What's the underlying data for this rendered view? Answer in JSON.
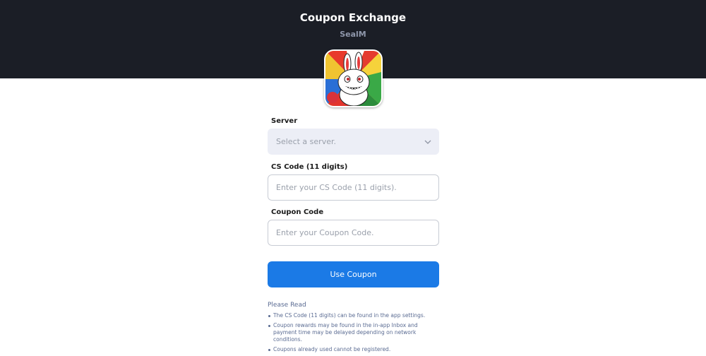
{
  "header": {
    "title": "Coupon Exchange",
    "game_name": "SealM"
  },
  "form": {
    "server": {
      "label": "Server",
      "placeholder": "Select a server."
    },
    "cs_code": {
      "label": "CS Code (11 digits)",
      "placeholder": "Enter your CS Code (11 digits)."
    },
    "coupon_code": {
      "label": "Coupon Code",
      "placeholder": "Enter your Coupon Code."
    },
    "submit_label": "Use Coupon"
  },
  "notes": {
    "title": "Please Read",
    "items": [
      "The CS Code (11 digits) can be found in the app settings.",
      "Coupon rewards may be found in the in-app Inbox and payment time may be delayed depending on network conditions.",
      "Coupons already used cannot be registered."
    ]
  },
  "colors": {
    "header_bg": "#1b1e26",
    "accent": "#1b7ae6",
    "select_bg": "#eceef6",
    "note_text": "#5a6b92"
  },
  "icons": {
    "game": "game-app-icon",
    "dropdown": "chevron-down-icon"
  }
}
